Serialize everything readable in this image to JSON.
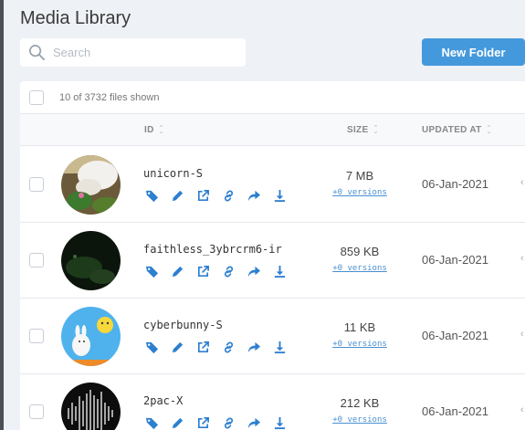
{
  "title": "Media Library",
  "search": {
    "placeholder": "Search",
    "value": ""
  },
  "new_folder_label": "New Folder",
  "count_text": "10 of 3732 files shown",
  "columns": {
    "id": "ID",
    "size": "SIZE",
    "updated": "UPDATED AT"
  },
  "icons": [
    "tag-icon",
    "pencil-icon",
    "external-link-icon",
    "link-icon",
    "share-icon",
    "download-icon"
  ],
  "accent_color": "#4499dd",
  "rows": [
    {
      "id": "unicorn-S",
      "size": "7 MB",
      "versions": "+0 versions",
      "updated": "06-Jan-2021"
    },
    {
      "id": "faithless_3ybrcrm6-ir",
      "size": "859 KB",
      "versions": "+0 versions",
      "updated": "06-Jan-2021"
    },
    {
      "id": "cyberbunny-S",
      "size": "11 KB",
      "versions": "+0 versions",
      "updated": "06-Jan-2021"
    },
    {
      "id": "2pac-X",
      "size": "212 KB",
      "versions": "+0 versions",
      "updated": "06-Jan-2021"
    }
  ]
}
